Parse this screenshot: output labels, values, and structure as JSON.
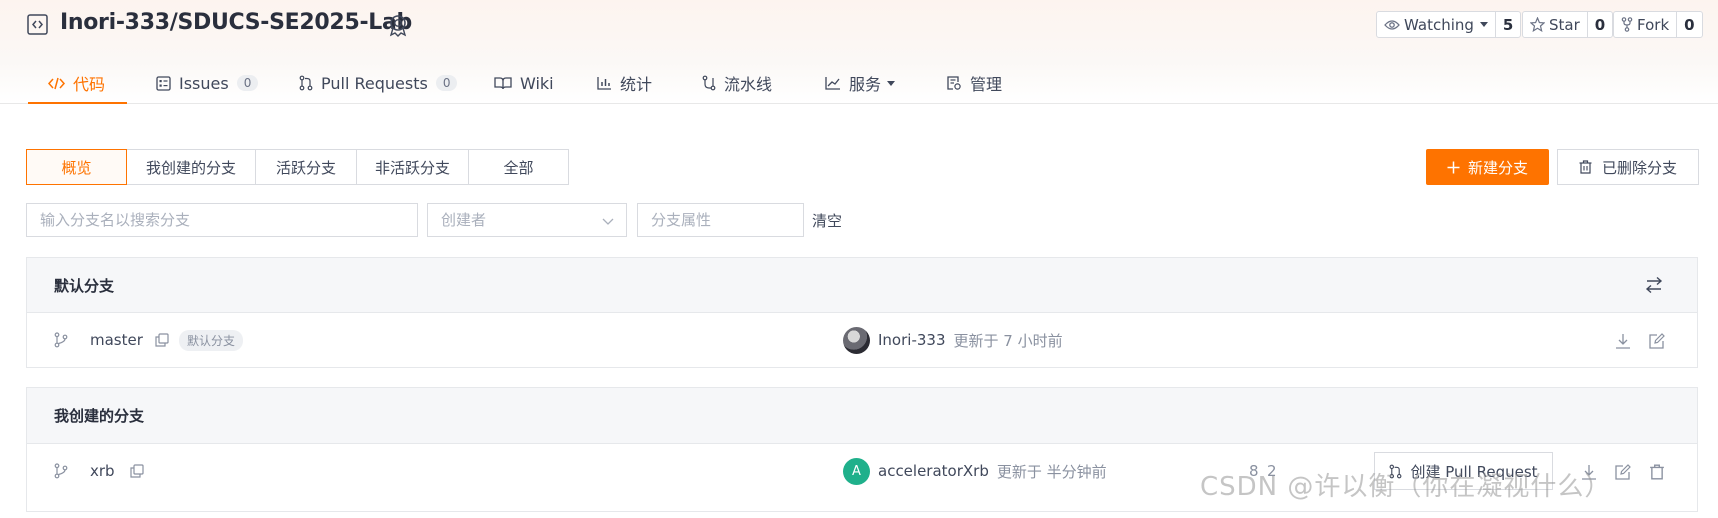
{
  "repo": {
    "title": "Inori-333/SDUCS-SE2025-Lab"
  },
  "stats": {
    "watching_label": "Watching",
    "watching_count": "5",
    "star_label": "Star",
    "star_count": "0",
    "fork_label": "Fork",
    "fork_count": "0"
  },
  "tabs": [
    {
      "label": "代码"
    },
    {
      "label": "Issues",
      "count": "0"
    },
    {
      "label": "Pull Requests",
      "count": "0"
    },
    {
      "label": "Wiki"
    },
    {
      "label": "统计"
    },
    {
      "label": "流水线"
    },
    {
      "label": "服务"
    },
    {
      "label": "管理"
    }
  ],
  "filters": [
    "概览",
    "我创建的分支",
    "活跃分支",
    "非活跃分支",
    "全部"
  ],
  "actions": {
    "new_branch": "新建分支",
    "deleted_branches": "已删除分支"
  },
  "search": {
    "branch_placeholder": "输入分支名以搜索分支",
    "creator_placeholder": "创建者",
    "attr_placeholder": "分支属性",
    "clear_label": "清空"
  },
  "sections": [
    {
      "title": "默认分支",
      "rows": [
        {
          "branch": "master",
          "tag": "默认分支",
          "author": "Inori-333",
          "updated": "更新于 7 小时前",
          "avatar_letter": ""
        }
      ]
    },
    {
      "title": "我创建的分支",
      "rows": [
        {
          "branch": "xrb",
          "author": "acceleratorXrb",
          "updated": "更新于 半分钟前",
          "avatar_letter": "A",
          "behind": "8",
          "ahead": "2",
          "pr_label": "创建 Pull Request"
        }
      ]
    }
  ],
  "watermark": "CSDN @许以衡（你在凝视什么）",
  "colors": {
    "accent": "#fe7300",
    "avatar_a": "#1fb08b"
  }
}
